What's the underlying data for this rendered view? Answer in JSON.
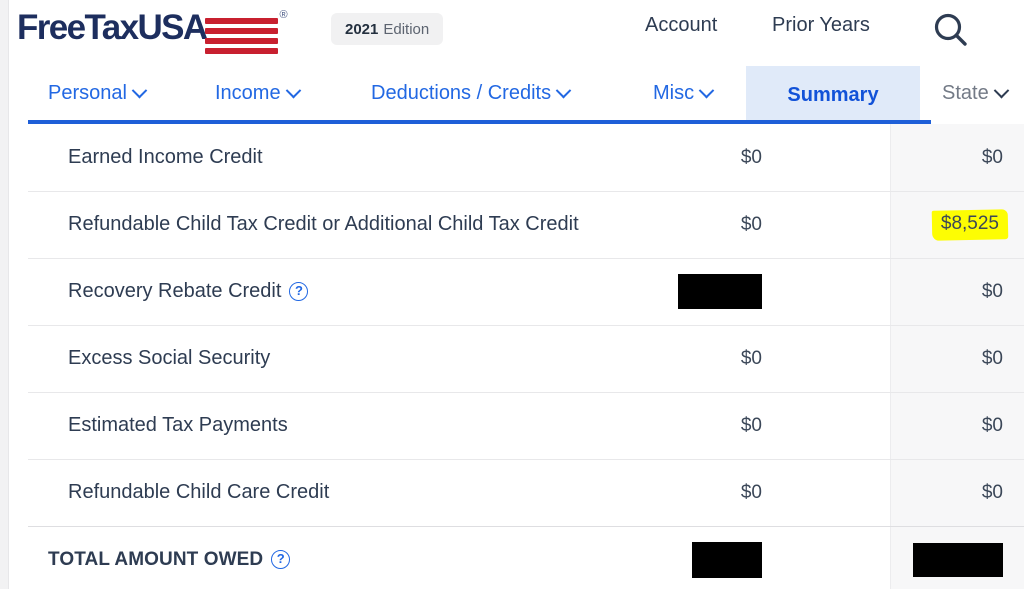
{
  "header": {
    "logo_text": "FreeTaxUSA",
    "logo_registered": "®",
    "edition_year": "2021",
    "edition_label": "Edition",
    "account_link": "Account",
    "prior_years_link": "Prior Years",
    "search_icon_name": "search-icon"
  },
  "nav": {
    "items": [
      {
        "label": "Personal",
        "has_caret": true,
        "active": false
      },
      {
        "label": "Income",
        "has_caret": true,
        "active": false
      },
      {
        "label": "Deductions / Credits",
        "has_caret": true,
        "active": false
      },
      {
        "label": "Misc",
        "has_caret": true,
        "active": false
      },
      {
        "label": "Summary",
        "has_caret": false,
        "active": true
      },
      {
        "label": "State",
        "has_caret": true,
        "active": false
      }
    ],
    "personal": "Personal",
    "income": "Income",
    "deductions": "Deductions / Credits",
    "misc": "Misc",
    "summary": "Summary",
    "state": "State",
    "accent_color": "#1e5fd8",
    "active_bg": "#e0eaf9"
  },
  "table": {
    "rows": [
      {
        "label": "Earned Income Credit",
        "has_help": false,
        "federal": "$0",
        "state": "$0",
        "federal_redacted": false,
        "state_redacted": false,
        "state_highlighted": false
      },
      {
        "label": "Refundable Child Tax Credit or Additional Child Tax Credit",
        "has_help": false,
        "federal": "$0",
        "state": "$8,525",
        "federal_redacted": false,
        "state_redacted": false,
        "state_highlighted": true
      },
      {
        "label": "Recovery Rebate Credit",
        "has_help": true,
        "federal": "",
        "state": "$0",
        "federal_redacted": true,
        "state_redacted": false,
        "state_highlighted": false
      },
      {
        "label": "Excess Social Security",
        "has_help": false,
        "federal": "$0",
        "state": "$0",
        "federal_redacted": false,
        "state_redacted": false,
        "state_highlighted": false
      },
      {
        "label": "Estimated Tax Payments",
        "has_help": false,
        "federal": "$0",
        "state": "$0",
        "federal_redacted": false,
        "state_redacted": false,
        "state_highlighted": false
      },
      {
        "label": "Refundable Child Care Credit",
        "has_help": false,
        "federal": "$0",
        "state": "$0",
        "federal_redacted": false,
        "state_redacted": false,
        "state_highlighted": false
      }
    ],
    "total_row": {
      "label": "TOTAL AMOUNT OWED",
      "has_help": true,
      "federal": "",
      "state": "",
      "federal_redacted": true,
      "state_redacted": true
    },
    "help_icon_glyph": "?",
    "highlight_color": "#fdfd03",
    "state_column_bg": "#f7f7f8"
  }
}
